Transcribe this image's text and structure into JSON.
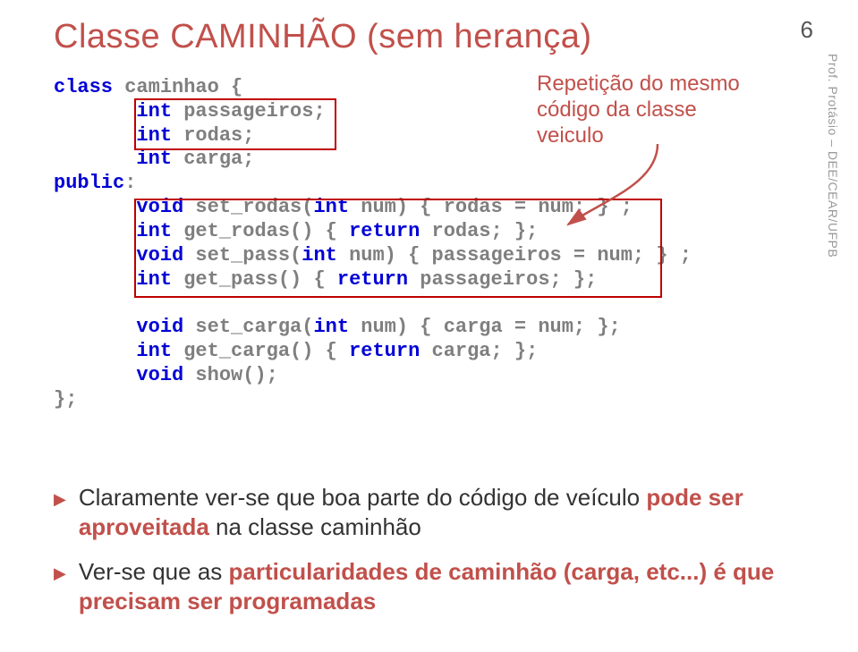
{
  "page_number": "6",
  "side_label": "Prof. Protásio – DEE/CEAR/UFPB",
  "title": "Classe CAMINHÃO (sem herança)",
  "annotation": "Repetição do mesmo código da classe veiculo",
  "code": {
    "l01_kw": "class",
    "l01_rest": " caminhao {",
    "l02_kw": "int",
    "l02_rest": " passageiros;",
    "l03_kw": "int",
    "l03_rest": " rodas;",
    "l04_kw": "int",
    "l04_rest": " carga;",
    "l05_kw": "public",
    "l05_rest": ":",
    "l06_kw1": "void",
    "l06_mid": " set_rodas(",
    "l06_kw2": "int",
    "l06_rest": " num) { rodas = num; } ;",
    "l07_kw1": "int",
    "l07_mid": " get_rodas() { ",
    "l07_kw2": "return",
    "l07_rest": " rodas; };",
    "l08_kw1": "void",
    "l08_mid": " set_pass(",
    "l08_kw2": "int",
    "l08_rest": " num) { passageiros = num; } ;",
    "l09_kw1": "int",
    "l09_mid": " get_pass() { ",
    "l09_kw2": "return",
    "l09_rest": " passageiros; };",
    "l10_kw1": "void",
    "l10_mid": " set_carga(",
    "l10_kw2": "int",
    "l10_rest": " num) { carga = num; };",
    "l11_kw1": "int",
    "l11_mid": " get_carga() { ",
    "l11_kw2": "return",
    "l11_rest": " carga; };",
    "l12_kw": "void",
    "l12_rest": " show();",
    "l13": "};"
  },
  "bullets": {
    "b1_pre": "Claramente ver-se que boa parte do código de veículo ",
    "b1_bold": "pode ser aproveitada",
    "b1_post": " na classe caminhão",
    "b2_pre": "Ver-se que as ",
    "b2_bold": "particularidades de caminhão (carga, etc...) é que precisam ser programadas",
    "b2_post": ""
  }
}
